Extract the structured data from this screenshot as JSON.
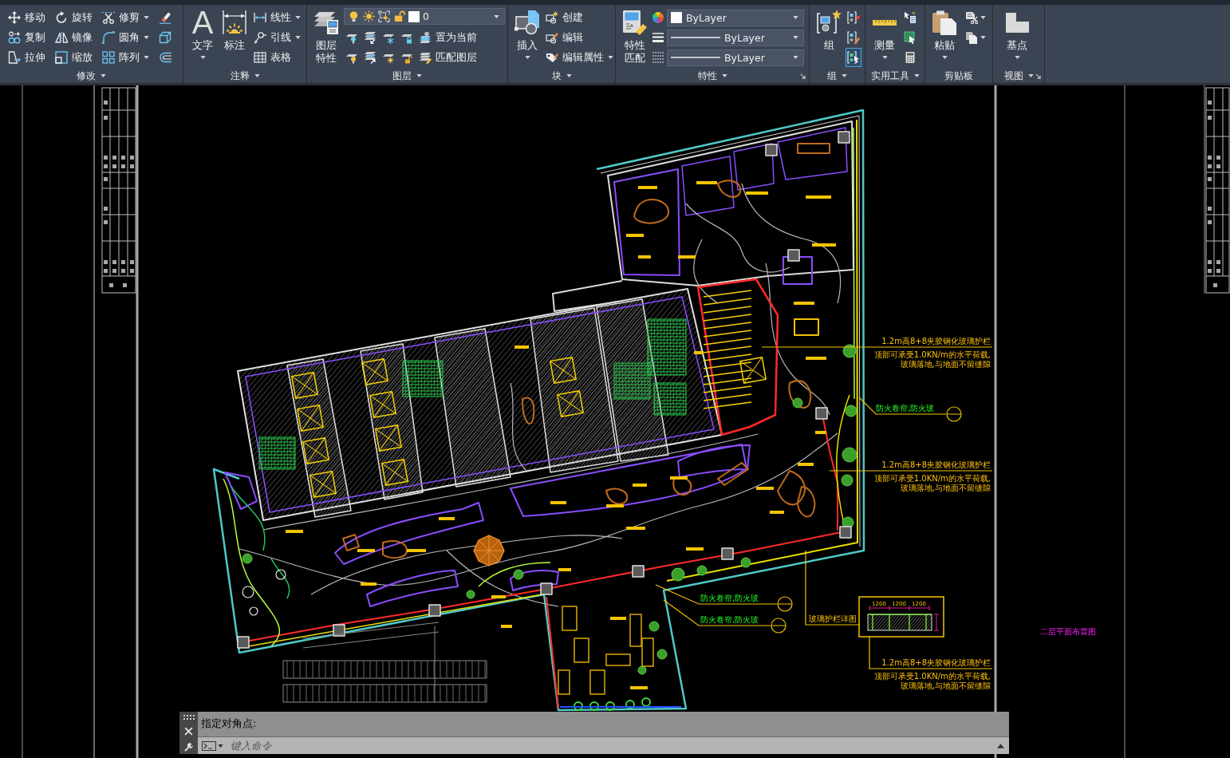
{
  "ribbon": {
    "panels": [
      {
        "title": "修改",
        "menu": true,
        "columns": [
          [
            {
              "kind": "small",
              "label": "移动"
            },
            {
              "kind": "small",
              "label": "复制"
            },
            {
              "kind": "small",
              "label": "拉伸"
            }
          ],
          [
            {
              "kind": "small",
              "label": "旋转"
            },
            {
              "kind": "small",
              "label": "镜像"
            },
            {
              "kind": "small",
              "label": "缩放"
            }
          ],
          [
            {
              "kind": "small",
              "label": "修剪",
              "menu": true
            },
            {
              "kind": "small",
              "label": "圆角",
              "menu": true
            },
            {
              "kind": "small",
              "label": "阵列",
              "menu": true
            }
          ],
          [
            {
              "kind": "icon"
            },
            {
              "kind": "icon"
            },
            {
              "kind": "icon"
            }
          ]
        ]
      },
      {
        "title": "注释",
        "menu": true,
        "columns": [
          [
            {
              "kind": "large",
              "glyph": "A",
              "label": "文字",
              "menu": true
            }
          ],
          [
            {
              "kind": "large",
              "label": "标注"
            }
          ],
          [
            {
              "kind": "small",
              "label": "线性",
              "menu": true
            },
            {
              "kind": "small",
              "label": "引线",
              "menu": true
            },
            {
              "kind": "small",
              "label": "表格"
            }
          ]
        ]
      },
      {
        "title": "图层",
        "menu": true,
        "columns": [
          [
            {
              "kind": "large",
              "label": "图层特性"
            }
          ],
          [
            {
              "kind": "layer_select",
              "value": "0",
              "visible": true,
              "frozen": false,
              "vp_frozen": false,
              "locked": false
            },
            {
              "kind": "strip",
              "tools": [
                {
                  "kind": "icon"
                },
                {
                  "kind": "icon"
                },
                {
                  "kind": "icon"
                },
                {
                  "kind": "icon"
                },
                {
                  "kind": "small",
                  "label": "置为当前"
                }
              ]
            },
            {
              "kind": "strip",
              "tools": [
                {
                  "kind": "icon"
                },
                {
                  "kind": "icon"
                },
                {
                  "kind": "icon"
                },
                {
                  "kind": "icon"
                },
                {
                  "kind": "small",
                  "label": "匹配图层"
                }
              ]
            }
          ]
        ]
      },
      {
        "title": "块",
        "menu": true,
        "columns": [
          [
            {
              "kind": "large",
              "label": "插入",
              "menu": true
            }
          ],
          [
            {
              "kind": "small",
              "label": "创建"
            },
            {
              "kind": "small",
              "label": "编辑"
            },
            {
              "kind": "small",
              "label": "编辑属性",
              "menu": true
            }
          ]
        ]
      },
      {
        "title": "特性",
        "menu": true,
        "launcher": true,
        "columns": [
          [
            {
              "kind": "large",
              "label": "特性匹配"
            }
          ],
          [
            {
              "kind": "color_select",
              "value": "ByLayer"
            },
            {
              "kind": "line_select",
              "value": "ByLayer"
            },
            {
              "kind": "line_select",
              "value": "ByLayer"
            }
          ]
        ]
      },
      {
        "title": "组",
        "menu": true,
        "columns": [
          [
            {
              "kind": "large",
              "label": "组"
            }
          ],
          [
            {
              "kind": "icon",
              "on": false
            },
            {
              "kind": "icon",
              "on": false
            },
            {
              "kind": "icon",
              "on": true
            }
          ]
        ]
      },
      {
        "title": "实用工具",
        "menu": true,
        "columns": [
          [
            {
              "kind": "large",
              "label": "测量",
              "menu": true
            }
          ],
          [
            {
              "kind": "icon"
            },
            {
              "kind": "icon"
            },
            {
              "kind": "icon"
            }
          ]
        ]
      },
      {
        "title": "剪贴板",
        "menu": false,
        "columns": [
          [
            {
              "kind": "large",
              "label": "粘贴",
              "menu": true
            }
          ],
          [
            {
              "kind": "icon",
              "menu": true
            },
            {
              "kind": "icon",
              "menu": true
            }
          ]
        ]
      },
      {
        "title": "视图",
        "menu": true,
        "launcher": true,
        "columns": [
          [
            {
              "kind": "large",
              "label": "基点",
              "menu": true
            }
          ]
        ]
      }
    ]
  },
  "drawing": {
    "notes": [
      {
        "title": "1.2m高8+8夹胶钢化玻璃护栏",
        "lines": [
          "顶部可承受1.0KN/m的水平荷载,",
          "玻璃落地,与地面不留缝隙"
        ]
      },
      {
        "title": "1.2m高8+8夹胶钢化玻璃护栏",
        "lines": [
          "顶部可承受1.0KN/m的水平荷载,",
          "玻璃落地,与地面不留缝隙"
        ]
      },
      {
        "title": "1.2m高8+8夹胶钢化玻璃护栏",
        "lines": [
          "顶部可承受1.0KN/m的水平荷载,",
          "玻璃落地,与地面不留缝隙"
        ]
      }
    ],
    "callouts": [
      {
        "label": "防火卷帘,防火玻"
      },
      {
        "label": "防火卷帘,防火玻"
      },
      {
        "label": "防火卷帘,防火玻"
      }
    ],
    "detail": {
      "title": "玻璃护栏详图",
      "dims": [
        "1200",
        "1200",
        "1200"
      ]
    },
    "sheet_label": "二层平面布置图"
  },
  "command_line": {
    "history": "指定对角点:",
    "placeholder": "键入命令"
  }
}
